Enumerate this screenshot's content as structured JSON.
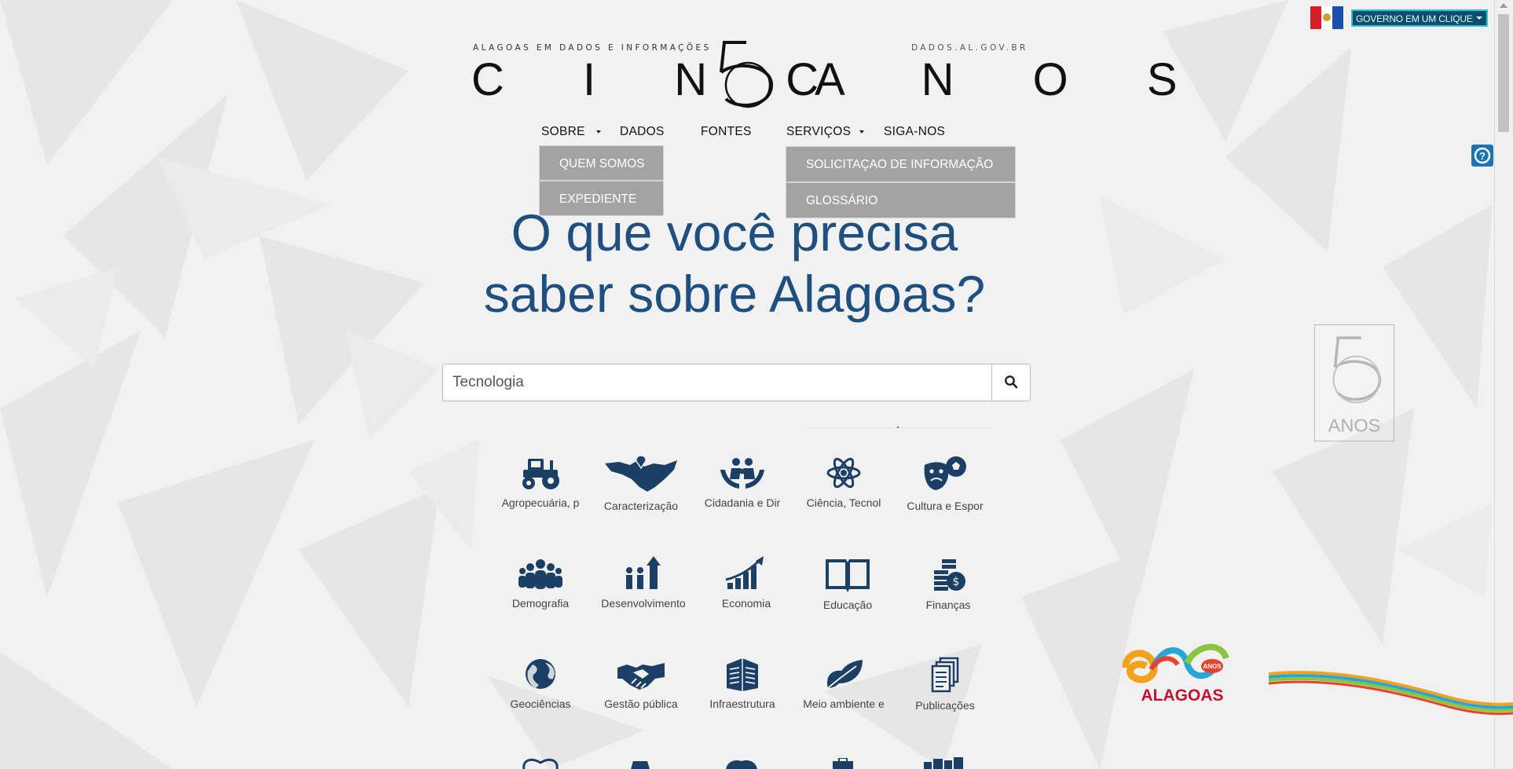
{
  "topbar": {
    "gov_button": "GOVERNO EM UM CLIQUE"
  },
  "header": {
    "tagline": "ALAGOAS EM DADOS E INFORMAÇÕES",
    "site_url": "DADOS.AL.GOV.BR",
    "logo_left": "C I N C",
    "logo_right": "A N O S"
  },
  "nav": {
    "items": [
      "SOBRE",
      "DADOS",
      "FONTES",
      "SERVIÇOS",
      "SIGA-NOS"
    ],
    "sobre_menu": [
      "QUEM SOMOS",
      "EXPEDIENTE"
    ],
    "servicos_menu": [
      "SOLICITAÇAO DE INFORMAÇÃO",
      "GLOSSÁRIO"
    ]
  },
  "hero": {
    "line1": "O que você precisa",
    "line2": "saber sobre Alagoas?"
  },
  "search": {
    "value": "Tecnologia"
  },
  "badge": {
    "label": "ANOS"
  },
  "categories": [
    "Agropecuária, p",
    "Caracterização",
    "Cidadania e Dir",
    "Ciência, Tecnol",
    "Cultura e Espor",
    "Demografia",
    "Desenvolvimento",
    "Economia",
    "Educação",
    "Finanças",
    "Geociências",
    "Gestão pública",
    "Infraestrutura",
    "Meio ambiente e",
    "Publicações"
  ],
  "icon_names": [
    "tractor-icon",
    "alagoas-map-icon",
    "family-hands-icon",
    "atom-icon",
    "masks-ball-icon",
    "people-group-icon",
    "growth-people-icon",
    "rising-chart-icon",
    "open-book-icon",
    "coins-icon",
    "globe-icon",
    "handshake-icon",
    "buildings-icon",
    "leaves-icon",
    "documents-icon"
  ],
  "colors": {
    "icon": "#1c3f66",
    "hero": "#1e4f7e",
    "dropdown": "#a3a3a3",
    "gov_button": "#0b4f6c"
  },
  "brand": {
    "logo_text": "ALAGOAS",
    "logo_small": "ANOS"
  }
}
